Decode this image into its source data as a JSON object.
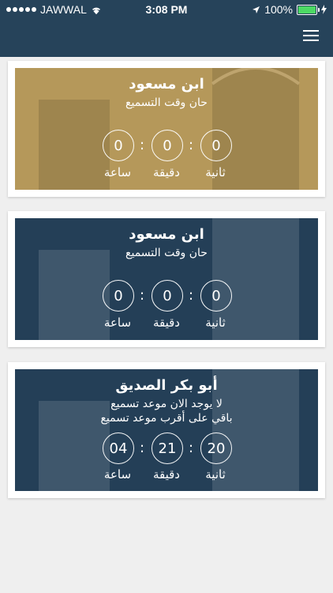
{
  "status_bar": {
    "carrier": "JAWWAL",
    "time": "3:08 PM",
    "battery": "100%"
  },
  "cards": [
    {
      "name": "ابن مسعود",
      "lines": [
        "حان وقت التسميع"
      ],
      "countdown": {
        "hours": "0",
        "minutes": "0",
        "seconds": "0"
      }
    },
    {
      "name": "ابن مسعود",
      "lines": [
        "حان وقت التسميع"
      ],
      "countdown": {
        "hours": "0",
        "minutes": "0",
        "seconds": "0"
      }
    },
    {
      "name": "أبو بكر الصديق",
      "lines": [
        "لا يوجد الان موعد تسميع",
        "باقي على أقرب موعد تسميع"
      ],
      "countdown": {
        "hours": "04",
        "minutes": "21",
        "seconds": "20"
      }
    }
  ],
  "units": {
    "hours": "ساعة",
    "minutes": "دقيقة",
    "seconds": "ثانية"
  },
  "colors": {
    "header": "#26435a",
    "gold_card": "#b5985a",
    "blue_card": "#243f57",
    "page_bg": "#efefef"
  }
}
